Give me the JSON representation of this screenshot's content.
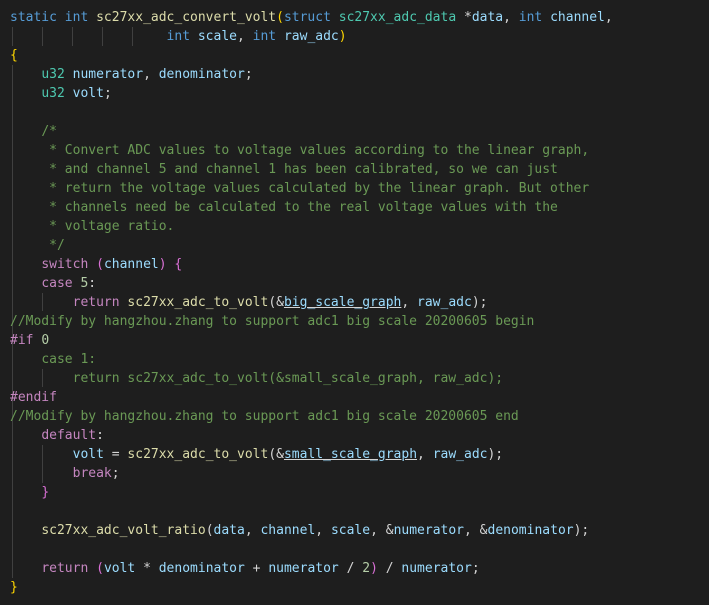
{
  "editor": {
    "language": "c",
    "theme_bg": "#1e1e1e",
    "colors": {
      "keyword": "#569cd6",
      "control": "#c586c0",
      "function": "#dcdcaa",
      "type": "#4ec9b0",
      "param": "#9cdcfe",
      "number": "#b5cea8",
      "comment": "#6a9955",
      "preprocessor": "#c586c0",
      "text": "#d4d4d4",
      "brace": "#ffd700"
    },
    "lines": [
      [
        [
          "kw",
          "static"
        ],
        [
          "txt",
          " "
        ],
        [
          "kw",
          "int"
        ],
        [
          "txt",
          " "
        ],
        [
          "fn",
          "sc27xx_adc_convert_volt"
        ],
        [
          "brace",
          "("
        ],
        [
          "kw",
          "struct"
        ],
        [
          "txt",
          " "
        ],
        [
          "ty",
          "sc27xx_adc_data"
        ],
        [
          "txt",
          " *"
        ],
        [
          "pm",
          "data"
        ],
        [
          "txt",
          ", "
        ],
        [
          "kw",
          "int"
        ],
        [
          "txt",
          " "
        ],
        [
          "pm",
          "channel"
        ],
        [
          "txt",
          ","
        ]
      ],
      [
        [
          "txt",
          "                    "
        ],
        [
          "kw",
          "int"
        ],
        [
          "txt",
          " "
        ],
        [
          "pm",
          "scale"
        ],
        [
          "txt",
          ", "
        ],
        [
          "kw",
          "int"
        ],
        [
          "txt",
          " "
        ],
        [
          "pm",
          "raw_adc"
        ],
        [
          "brace",
          ")"
        ]
      ],
      [
        [
          "brace",
          "{"
        ]
      ],
      [
        [
          "txt",
          "    "
        ],
        [
          "ty",
          "u32"
        ],
        [
          "txt",
          " "
        ],
        [
          "pm",
          "numerator"
        ],
        [
          "txt",
          ", "
        ],
        [
          "pm",
          "denominator"
        ],
        [
          "txt",
          ";"
        ]
      ],
      [
        [
          "txt",
          "    "
        ],
        [
          "ty",
          "u32"
        ],
        [
          "txt",
          " "
        ],
        [
          "pm",
          "volt"
        ],
        [
          "txt",
          ";"
        ]
      ],
      [
        [
          "txt",
          ""
        ]
      ],
      [
        [
          "txt",
          "    "
        ],
        [
          "cm",
          "/*"
        ]
      ],
      [
        [
          "txt",
          "     "
        ],
        [
          "cm",
          "* Convert ADC values to voltage values according to the linear graph,"
        ]
      ],
      [
        [
          "txt",
          "     "
        ],
        [
          "cm",
          "* and channel 5 and channel 1 has been calibrated, so we can just"
        ]
      ],
      [
        [
          "txt",
          "     "
        ],
        [
          "cm",
          "* return the voltage values calculated by the linear graph. But other"
        ]
      ],
      [
        [
          "txt",
          "     "
        ],
        [
          "cm",
          "* channels need be calculated to the real voltage values with the"
        ]
      ],
      [
        [
          "txt",
          "     "
        ],
        [
          "cm",
          "* voltage ratio."
        ]
      ],
      [
        [
          "txt",
          "     "
        ],
        [
          "cm",
          "*/"
        ]
      ],
      [
        [
          "txt",
          "    "
        ],
        [
          "ctl",
          "switch"
        ],
        [
          "txt",
          " "
        ],
        [
          "paren",
          "("
        ],
        [
          "pm",
          "channel"
        ],
        [
          "paren",
          ")"
        ],
        [
          "txt",
          " "
        ],
        [
          "paren",
          "{"
        ]
      ],
      [
        [
          "txt",
          "    "
        ],
        [
          "ctl",
          "case"
        ],
        [
          "txt",
          " "
        ],
        [
          "num",
          "5"
        ],
        [
          "txt",
          ":"
        ]
      ],
      [
        [
          "txt",
          "        "
        ],
        [
          "ctl",
          "return"
        ],
        [
          "txt",
          " "
        ],
        [
          "fn",
          "sc27xx_adc_to_volt"
        ],
        [
          "txt",
          "(&"
        ],
        [
          "pm",
          "big_scale_graph"
        ],
        [
          "txt",
          ", "
        ],
        [
          "pm",
          "raw_adc"
        ],
        [
          "txt",
          ");"
        ]
      ],
      [
        [
          "cm",
          "//Modify by hangzhou.zhang to support adc1 big scale 20200605 begin"
        ]
      ],
      [
        [
          "pp",
          "#if"
        ],
        [
          "txt",
          " "
        ],
        [
          "num",
          "0"
        ]
      ],
      [
        [
          "txt",
          "    "
        ],
        [
          "cm",
          "case 1:"
        ]
      ],
      [
        [
          "txt",
          "        "
        ],
        [
          "cm",
          "return sc27xx_adc_to_volt(&small_scale_graph, raw_adc);"
        ]
      ],
      [
        [
          "pp",
          "#endif"
        ]
      ],
      [
        [
          "cm",
          "//Modify by hangzhou.zhang to support adc1 big scale 20200605 end"
        ]
      ],
      [
        [
          "txt",
          "    "
        ],
        [
          "ctl",
          "default"
        ],
        [
          "txt",
          ":"
        ]
      ],
      [
        [
          "txt",
          "        "
        ],
        [
          "pm",
          "volt"
        ],
        [
          "txt",
          " = "
        ],
        [
          "fn",
          "sc27xx_adc_to_volt"
        ],
        [
          "txt",
          "(&"
        ],
        [
          "pm",
          "small_scale_graph"
        ],
        [
          "txt",
          ", "
        ],
        [
          "pm",
          "raw_adc"
        ],
        [
          "txt",
          ");"
        ]
      ],
      [
        [
          "txt",
          "        "
        ],
        [
          "ctl",
          "break"
        ],
        [
          "txt",
          ";"
        ]
      ],
      [
        [
          "txt",
          "    "
        ],
        [
          "paren",
          "}"
        ]
      ],
      [
        [
          "txt",
          ""
        ]
      ],
      [
        [
          "txt",
          "    "
        ],
        [
          "fn",
          "sc27xx_adc_volt_ratio"
        ],
        [
          "txt",
          "("
        ],
        [
          "pm",
          "data"
        ],
        [
          "txt",
          ", "
        ],
        [
          "pm",
          "channel"
        ],
        [
          "txt",
          ", "
        ],
        [
          "pm",
          "scale"
        ],
        [
          "txt",
          ", &"
        ],
        [
          "pm",
          "numerator"
        ],
        [
          "txt",
          ", &"
        ],
        [
          "pm",
          "denominator"
        ],
        [
          "txt",
          ");"
        ]
      ],
      [
        [
          "txt",
          ""
        ]
      ],
      [
        [
          "txt",
          "    "
        ],
        [
          "ctl",
          "return"
        ],
        [
          "txt",
          " "
        ],
        [
          "paren",
          "("
        ],
        [
          "pm",
          "volt"
        ],
        [
          "txt",
          " * "
        ],
        [
          "pm",
          "denominator"
        ],
        [
          "txt",
          " + "
        ],
        [
          "pm",
          "numerator"
        ],
        [
          "txt",
          " / "
        ],
        [
          "num",
          "2"
        ],
        [
          "paren",
          ")"
        ],
        [
          "txt",
          " / "
        ],
        [
          "pm",
          "numerator"
        ],
        [
          "txt",
          ";"
        ]
      ],
      [
        [
          "brace",
          "}"
        ]
      ]
    ]
  }
}
